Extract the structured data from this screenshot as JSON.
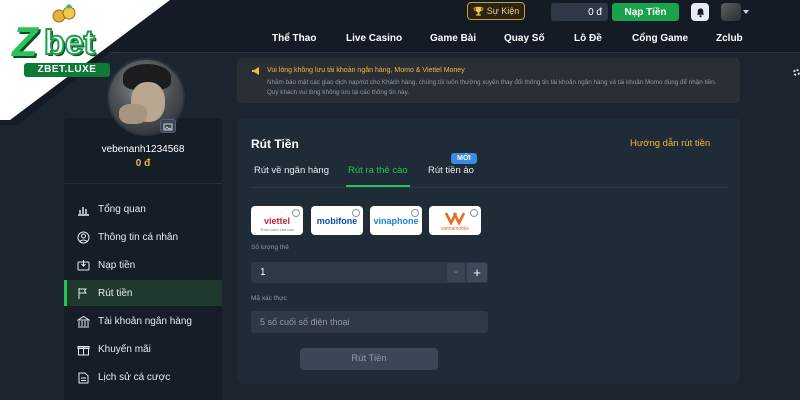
{
  "logo": {
    "mark_z": "Z",
    "mark_bet": "bet",
    "domain": "ZBET.LUXE"
  },
  "header": {
    "event_label": "Sự Kiện",
    "balance": "0 đ",
    "deposit_label": "Nạp Tiền",
    "nav": [
      "Thể Thao",
      "Live Casino",
      "Game Bài",
      "Quay Số",
      "Lô Đề",
      "Cổng Game",
      "Zclub"
    ]
  },
  "profile": {
    "username": "vebenanh1234568",
    "balance": "0 đ"
  },
  "sidebar": {
    "items": [
      {
        "label": "Tổng quan",
        "icon": "chart-icon"
      },
      {
        "label": "Thông tin cá nhân",
        "icon": "user-icon"
      },
      {
        "label": "Nạp tiền",
        "icon": "deposit-icon"
      },
      {
        "label": "Rút tiền",
        "icon": "withdraw-icon",
        "active": true
      },
      {
        "label": "Tài khoản ngân hàng",
        "icon": "bank-icon"
      },
      {
        "label": "Khuyến mãi",
        "icon": "gift-icon"
      },
      {
        "label": "Lịch sử cá cược",
        "icon": "history-icon"
      }
    ]
  },
  "notice": {
    "title": "Vui lòng không lưu tài khoản ngân hàng, Momo & Viettel Money",
    "body": "Nhằm bảo mật các giao dịch nạp/rút cho Khách hàng, chúng tôi luôn thường xuyên thay đổi thông tin tài khoản ngân hàng và tài khoản Momo dùng để nhận tiền. Quý khách vui lòng không lưu lại các thông tin này."
  },
  "withdraw": {
    "title": "Rút Tiền",
    "guide_link": "Hướng dẫn rút tiền",
    "tabs": [
      "Rút về ngân hàng",
      "Rút ra thẻ cào",
      "Rút tiền ảo"
    ],
    "active_tab": 1,
    "new_badge": "MỚI",
    "providers": [
      {
        "name": "viettel",
        "sub": "Theo cách của bạn"
      },
      {
        "name": "mobifone",
        "sub": ""
      },
      {
        "name": "vinaphone",
        "sub": ""
      },
      {
        "name": "vietnamobile",
        "sub": ""
      }
    ],
    "quantity_label": "Số lượng thẻ",
    "quantity_value": "1",
    "minus": "-",
    "plus": "+",
    "code_label": "Mã xác thực",
    "code_placeholder": "5 số cuối số điện thoại",
    "submit_label": "Rút Tiền"
  },
  "colors": {
    "accent_green": "#24c45a",
    "accent_gold": "#f0b93a",
    "card_bg": "#202b38",
    "page_bg": "#1c2430"
  }
}
